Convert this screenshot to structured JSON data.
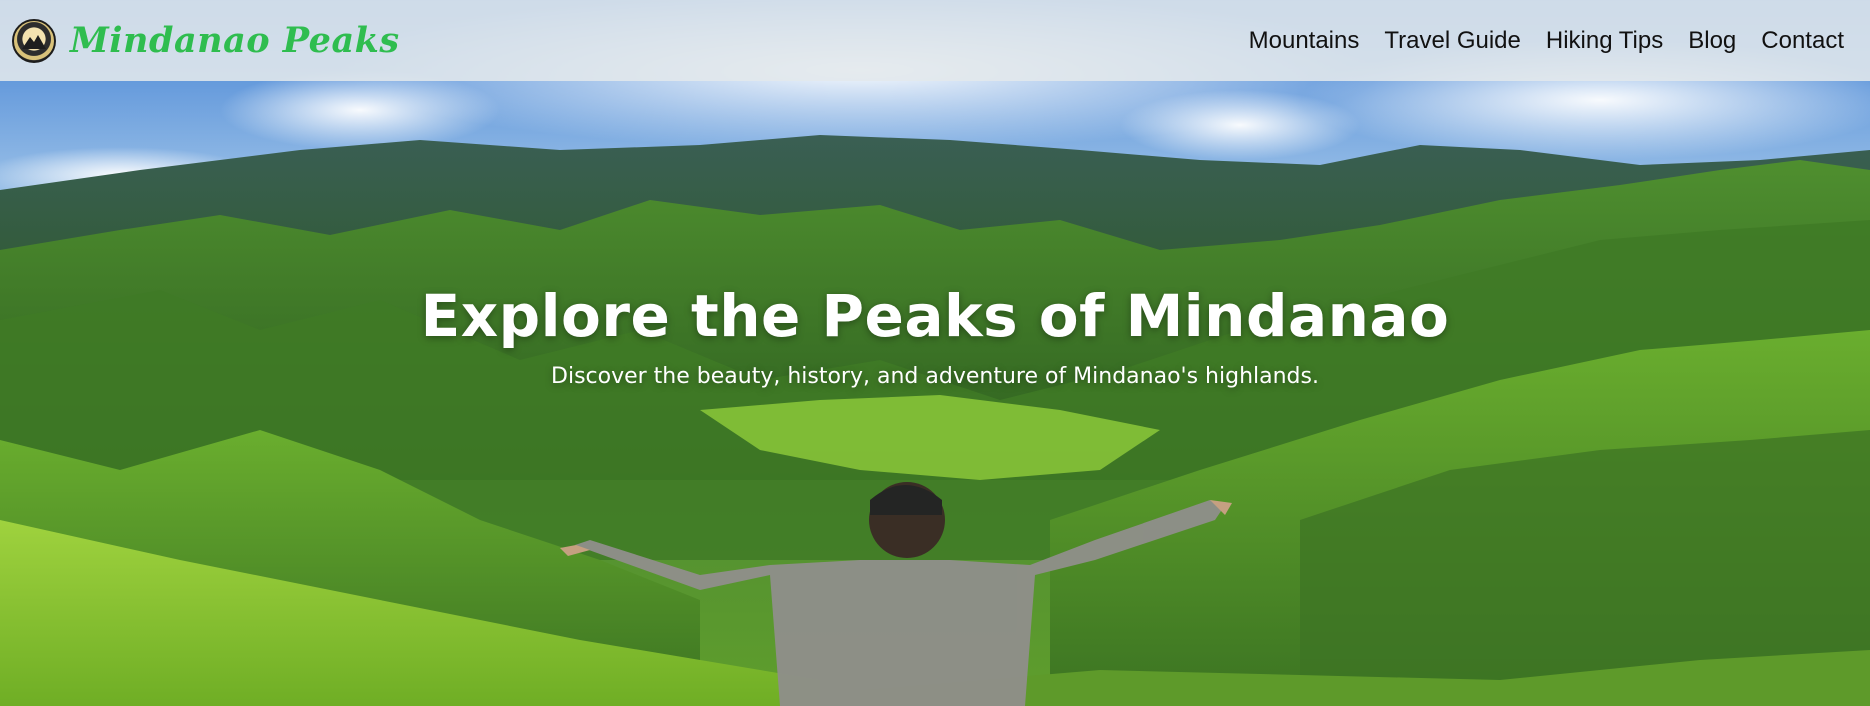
{
  "site": {
    "brand_name": "Mindanao Peaks",
    "logo_icon": "mountain-badge-icon"
  },
  "nav": {
    "items": [
      {
        "label": "Mountains"
      },
      {
        "label": "Travel Guide"
      },
      {
        "label": "Hiking Tips"
      },
      {
        "label": "Blog"
      },
      {
        "label": "Contact"
      }
    ]
  },
  "hero": {
    "title": "Explore the Peaks of Mindanao",
    "subtitle": "Discover the beauty, history, and adventure of Mindanao's highlands.",
    "image": "green-mountain-landscape-hiker-arms-outstretched"
  },
  "colors": {
    "brand_green": "#2fbd4f",
    "nav_bg": "#e2e8ec",
    "nav_text": "#111111",
    "hero_text": "#ffffff"
  }
}
